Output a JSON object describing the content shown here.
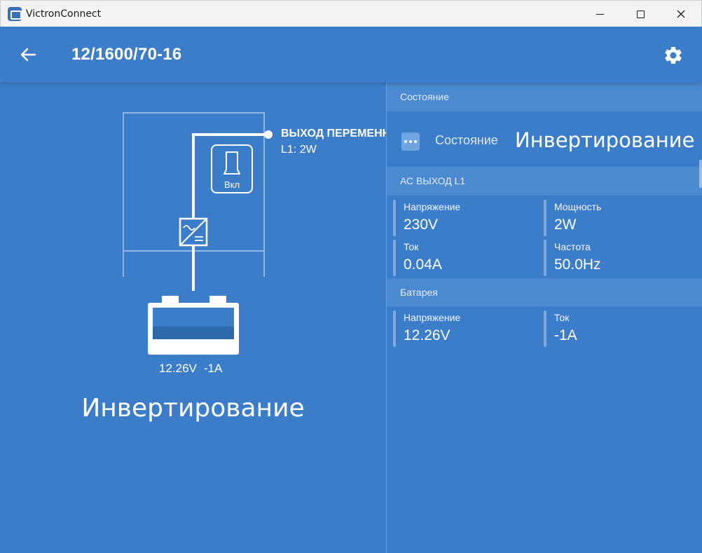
{
  "window": {
    "title": "VictronConnect"
  },
  "header": {
    "device_name": "12/1600/70-16"
  },
  "diagram": {
    "output_title": "ВЫХОД ПЕРЕМЕНН",
    "output_value": "L1: 2W",
    "switch_label": "Вкл",
    "battery_voltage": "12.26V",
    "battery_current": "-1A",
    "state": "Инвертирование"
  },
  "state_section": {
    "header": "Состояние",
    "label": "Состояние",
    "value": "Инвертирование"
  },
  "ac_section": {
    "header": "АС ВЫХОД L1",
    "voltage_label": "Напряжение",
    "voltage_value": "230V",
    "power_label": "Мощность",
    "power_value": "2W",
    "current_label": "Ток",
    "current_value": "0.04A",
    "frequency_label": "Частота",
    "frequency_value": "50.0Hz"
  },
  "battery_section": {
    "header": "Батарея",
    "voltage_label": "Напряжение",
    "voltage_value": "12.26V",
    "current_label": "Ток",
    "current_value": "-1A"
  },
  "colors": {
    "background": "#3b7dc8",
    "section_header": "#4b89d0",
    "battery_fill": "#2d69a8"
  }
}
